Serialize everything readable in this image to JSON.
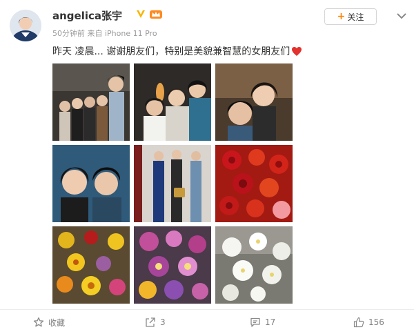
{
  "post": {
    "user": {
      "name": "angelica张宇",
      "avatar_icon": "user-avatar-photo",
      "verified_icon": "verified-v-icon",
      "member_icon": "member-crown-icon"
    },
    "time": "50分钟前",
    "source": "来自 iPhone 11 Pro",
    "follow_label": "关注",
    "more_icon": "chevron-down-icon",
    "text": "昨天 凌晨... 谢谢朋友们，特别是美貌兼智慧的女朋友们",
    "emoji_icon": "red-heart-icon",
    "photos": [
      {
        "name": "group-photo-friends"
      },
      {
        "name": "selfie-three-women"
      },
      {
        "name": "selfie-two-women"
      },
      {
        "name": "selfie-couple-smiling"
      },
      {
        "name": "friends-standing-bag"
      },
      {
        "name": "red-roses-bouquet"
      },
      {
        "name": "yellow-flowers-bouquet"
      },
      {
        "name": "purple-orchids"
      },
      {
        "name": "white-orchids"
      }
    ],
    "actions": {
      "favorite_label": "收藏",
      "repost_count": "3",
      "comment_count": "17",
      "like_count": "156"
    }
  }
}
